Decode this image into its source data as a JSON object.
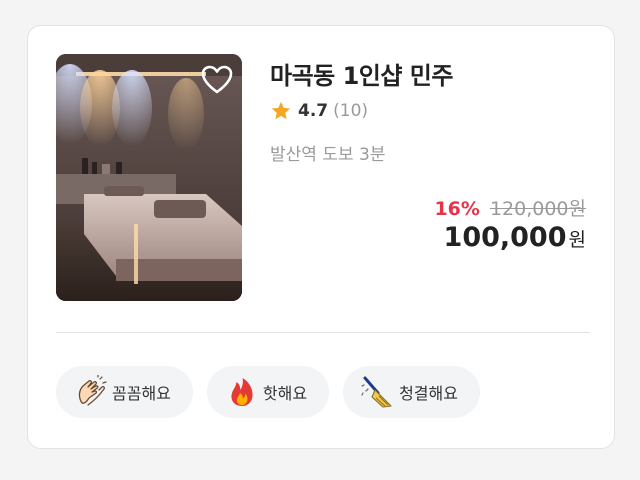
{
  "listing": {
    "title": "마곡동 1인샵 민주",
    "rating": "4.7",
    "review_count": "(10)",
    "location": "발산역 도보 3분",
    "discount": "16%",
    "original_price": "120,000원",
    "price": "100,000",
    "currency": "원",
    "favorited": false
  },
  "tags": [
    {
      "label": "꼼꼼해요",
      "icon": "clapping-hands-icon"
    },
    {
      "label": "핫해요",
      "icon": "fire-icon"
    },
    {
      "label": "청결해요",
      "icon": "broom-icon"
    }
  ],
  "colors": {
    "discount": "#e8344b",
    "star": "#f5a623",
    "muted_text": "#9a9a9a",
    "tag_bg": "#f3f4f6"
  }
}
